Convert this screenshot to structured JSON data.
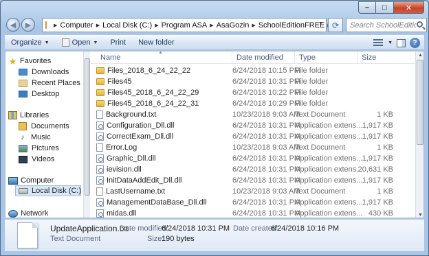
{
  "window": {
    "controls": {
      "minimize": "–",
      "maximize": "□",
      "close": "✕"
    }
  },
  "address": {
    "breadcrumbs": [
      "Computer",
      "Local Disk (C:)",
      "Program ASA",
      "AsaGozin",
      "SchoolEditionFREE"
    ],
    "search_placeholder": "Search SchoolEdition..."
  },
  "toolbar": {
    "organize": "Organize",
    "open": "Open",
    "print": "Print",
    "new_folder": "New folder"
  },
  "nav": {
    "favorites": "Favorites",
    "downloads": "Downloads",
    "recent_places": "Recent Places",
    "desktop": "Desktop",
    "libraries": "Libraries",
    "documents": "Documents",
    "music": "Music",
    "pictures": "Pictures",
    "videos": "Videos",
    "computer": "Computer",
    "local_disk": "Local Disk (C:)",
    "network": "Network"
  },
  "columns": {
    "name": "Name",
    "date": "Date modified",
    "type": "Type",
    "size": "Size"
  },
  "files": [
    {
      "name": "Files_2018_6_24_22_22",
      "date": "6/24/2018 10:15 PM",
      "type": "File folder",
      "size": "",
      "kind": "folder"
    },
    {
      "name": "Files45",
      "date": "6/24/2018 10:31 PM",
      "type": "File folder",
      "size": "",
      "kind": "folder"
    },
    {
      "name": "Files45_2018_6_24_22_29",
      "date": "6/24/2018 10:22 PM",
      "type": "File folder",
      "size": "",
      "kind": "folder"
    },
    {
      "name": "Files45_2018_6_24_22_31",
      "date": "6/24/2018 10:29 PM",
      "type": "File folder",
      "size": "",
      "kind": "folder"
    },
    {
      "name": "Background.txt",
      "date": "10/23/2018 9:03 AM",
      "type": "Text Document",
      "size": "1 KB",
      "kind": "file"
    },
    {
      "name": "Configuration_Dll.dll",
      "date": "6/24/2018 10:31 PM",
      "type": "Application extens...",
      "size": "1,917 KB",
      "kind": "dll"
    },
    {
      "name": "CorrectExam_Dll.dll",
      "date": "6/24/2018 10:31 PM",
      "type": "Application extens...",
      "size": "1,917 KB",
      "kind": "dll"
    },
    {
      "name": "Error.Log",
      "date": "10/23/2018 9:03 AM",
      "type": "Text Document",
      "size": "1 KB",
      "kind": "file"
    },
    {
      "name": "Graphic_Dll.dll",
      "date": "6/24/2018 10:31 PM",
      "type": "Application extens...",
      "size": "1,917 KB",
      "kind": "dll"
    },
    {
      "name": "ievision.dll",
      "date": "6/24/2018 10:31 PM",
      "type": "Application extens...",
      "size": "20,631 KB",
      "kind": "dll"
    },
    {
      "name": "InitDataAddEdit_Dll.dll",
      "date": "6/24/2018 10:31 PM",
      "type": "Application extens...",
      "size": "1,917 KB",
      "kind": "dll"
    },
    {
      "name": "LastUsername.txt",
      "date": "10/23/2018 9:03 AM",
      "type": "Text Document",
      "size": "1 KB",
      "kind": "file"
    },
    {
      "name": "ManagementDataBase_Dll.dll",
      "date": "6/24/2018 10:31 PM",
      "type": "Application extens...",
      "size": "1,917 KB",
      "kind": "dll"
    },
    {
      "name": "midas.dll",
      "date": "6/24/2018 10:31 PM",
      "type": "Application extens...",
      "size": "430 KB",
      "kind": "dll"
    }
  ],
  "details": {
    "filename": "UpdateApplication.txt",
    "modified_label": "Date modified:",
    "modified_value": "6/24/2018 10:31 PM",
    "created_label": "Date created:",
    "created_value": "6/24/2018 10:16 PM",
    "type": "Text Document",
    "size_label": "Size:",
    "size_value": "190 bytes"
  }
}
